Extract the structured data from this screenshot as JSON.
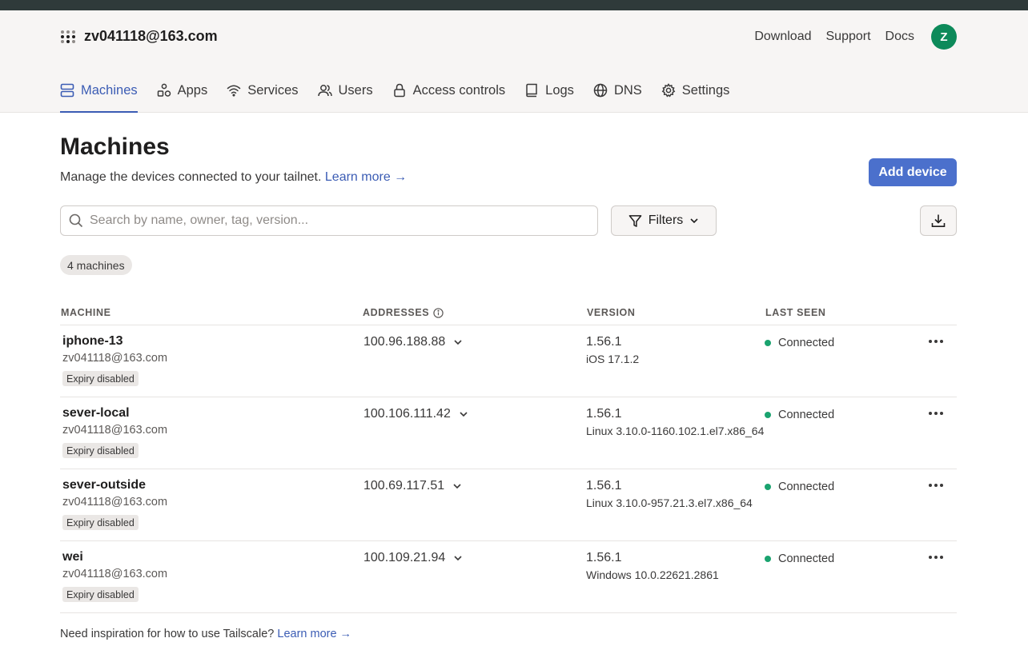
{
  "header": {
    "account_name": "zv041118@163.com",
    "links": [
      "Download",
      "Support",
      "Docs"
    ],
    "avatar_initial": "Z",
    "avatar_color": "#0d8a5a"
  },
  "nav": {
    "tabs": [
      {
        "label": "Machines",
        "icon": "server-icon",
        "active": true
      },
      {
        "label": "Apps",
        "icon": "apps-icon",
        "active": false
      },
      {
        "label": "Services",
        "icon": "wifi-icon",
        "active": false
      },
      {
        "label": "Users",
        "icon": "users-icon",
        "active": false
      },
      {
        "label": "Access controls",
        "icon": "lock-icon",
        "active": false
      },
      {
        "label": "Logs",
        "icon": "book-icon",
        "active": false
      },
      {
        "label": "DNS",
        "icon": "globe-icon",
        "active": false
      },
      {
        "label": "Settings",
        "icon": "gear-icon",
        "active": false
      }
    ]
  },
  "page": {
    "title": "Machines",
    "subtitle": "Manage the devices connected to your tailnet.",
    "learn_more": "Learn more →",
    "add_device": "Add device",
    "search_placeholder": "Search by name, owner, tag, version...",
    "filters_label": "Filters",
    "machine_count": "4 machines"
  },
  "table": {
    "headers": {
      "machine": "MACHINE",
      "addresses": "ADDRESSES",
      "version": "VERSION",
      "last_seen": "LAST SEEN"
    },
    "rows": [
      {
        "name": "iphone-13",
        "owner": "zv041118@163.com",
        "badge": "Expiry disabled",
        "address": "100.96.188.88",
        "version": "1.56.1",
        "os": "iOS 17.1.2",
        "status": "Connected"
      },
      {
        "name": "sever-local",
        "owner": "zv041118@163.com",
        "badge": "Expiry disabled",
        "address": "100.106.111.42",
        "version": "1.56.1",
        "os": "Linux 3.10.0-1160.102.1.el7.x86_64",
        "status": "Connected"
      },
      {
        "name": "sever-outside",
        "owner": "zv041118@163.com",
        "badge": "Expiry disabled",
        "address": "100.69.117.51",
        "version": "1.56.1",
        "os": "Linux 3.10.0-957.21.3.el7.x86_64",
        "status": "Connected"
      },
      {
        "name": "wei",
        "owner": "zv041118@163.com",
        "badge": "Expiry disabled",
        "address": "100.109.21.94",
        "version": "1.56.1",
        "os": "Windows 10.0.22621.2861",
        "status": "Connected"
      }
    ]
  },
  "footer": {
    "text": "Need inspiration for how to use Tailscale?",
    "link": "Learn more →"
  },
  "colors": {
    "accent": "#3b5cb4",
    "button": "#4b70cc",
    "connected": "#1aa36f"
  }
}
